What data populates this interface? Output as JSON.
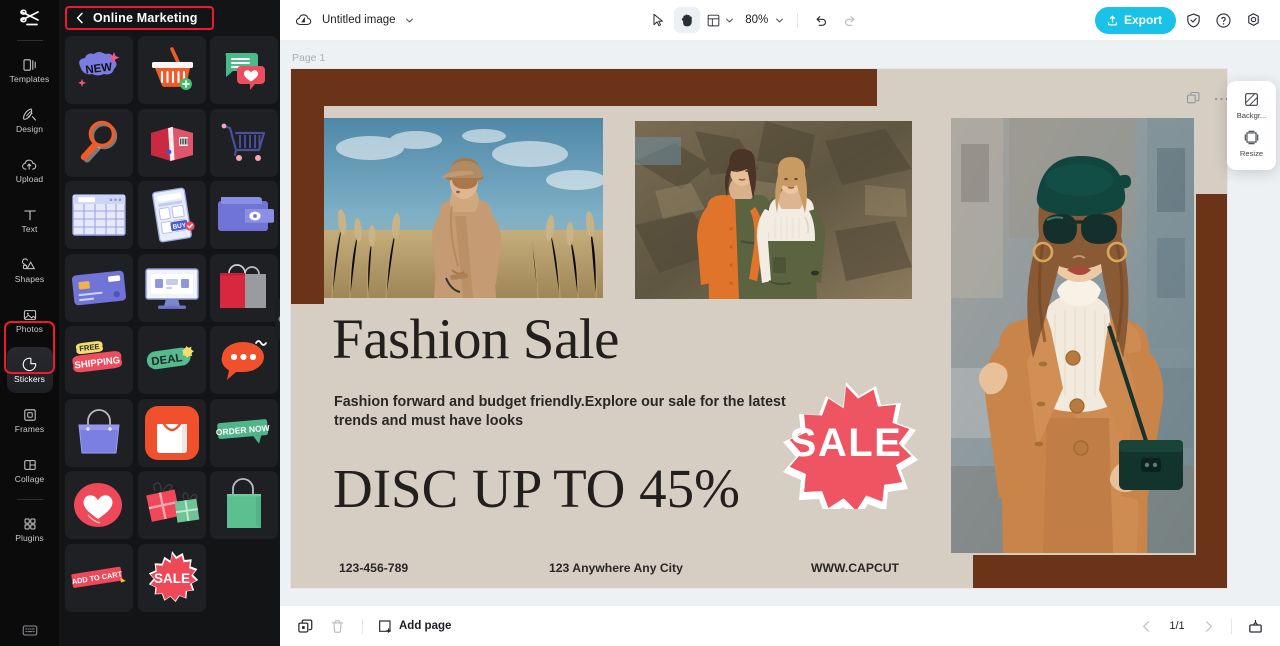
{
  "app": {
    "logo_icon": "capcut-logo-icon",
    "accent": "#19c2e6",
    "selection_outline": "#ee1b2e",
    "panel_bg": "#131416",
    "rail_bg": "#0b0b0c"
  },
  "rail": {
    "items": [
      {
        "label": "Templates",
        "icon": "templates-icon",
        "active": false
      },
      {
        "label": "Design",
        "icon": "design-icon",
        "active": false
      },
      {
        "label": "Upload",
        "icon": "upload-cloud-icon",
        "active": false
      },
      {
        "label": "Text",
        "icon": "text-icon",
        "active": false
      },
      {
        "label": "Shapes",
        "icon": "shapes-icon",
        "active": false
      },
      {
        "label": "Photos",
        "icon": "photos-icon",
        "active": false
      },
      {
        "label": "Stickers",
        "icon": "stickers-icon",
        "active": true
      },
      {
        "label": "Frames",
        "icon": "frames-icon",
        "active": false
      },
      {
        "label": "Collage",
        "icon": "collage-icon",
        "active": false
      },
      {
        "label": "Plugins",
        "icon": "plugins-icon",
        "active": false
      }
    ],
    "bottom_icon": "keyboard-shortcuts-icon"
  },
  "panel": {
    "back_icon": "chevron-left-icon",
    "title": "Online Marketing",
    "stickers": [
      {
        "name": "new-badge-sticker",
        "label": "NEW"
      },
      {
        "name": "shopping-basket-sticker",
        "label": ""
      },
      {
        "name": "chat-bubbles-heart-sticker",
        "label": ""
      },
      {
        "name": "magnifier-sticker",
        "label": ""
      },
      {
        "name": "parcel-box-sticker",
        "label": ""
      },
      {
        "name": "shopping-cart-outline-sticker",
        "label": ""
      },
      {
        "name": "calendar-sticker",
        "label": ""
      },
      {
        "name": "mobile-buy-sticker",
        "label": "BUY"
      },
      {
        "name": "wallet-sticker",
        "label": ""
      },
      {
        "name": "credit-card-sticker",
        "label": ""
      },
      {
        "name": "desktop-monitor-sticker",
        "label": ""
      },
      {
        "name": "paper-bags-sticker",
        "label": ""
      },
      {
        "name": "free-shipping-sticker",
        "label": "FREE SHIPPING"
      },
      {
        "name": "deal-sticker",
        "label": "DEAL"
      },
      {
        "name": "chat-dots-sticker",
        "label": ""
      },
      {
        "name": "handbag-outline-sticker",
        "label": ""
      },
      {
        "name": "shopping-bag-app-sticker",
        "label": ""
      },
      {
        "name": "order-now-sticker",
        "label": "ORDER NOW"
      },
      {
        "name": "heart-circle-sticker",
        "label": ""
      },
      {
        "name": "gift-boxes-sticker",
        "label": ""
      },
      {
        "name": "green-bag-sticker",
        "label": ""
      },
      {
        "name": "add-to-cart-sticker",
        "label": "ADD TO CART"
      },
      {
        "name": "sale-starburst-sticker",
        "label": "SALE"
      }
    ],
    "collapse_handle_icon": "panel-collapse-handle"
  },
  "topbar": {
    "project_icon": "cloud-saved-icon",
    "doc_title": "Untitled image",
    "title_caret_icon": "chevron-down-icon",
    "tools": [
      {
        "name": "select-tool",
        "icon": "cursor-arrow-icon",
        "selected": false
      },
      {
        "name": "hand-tool",
        "icon": "hand-icon",
        "selected": true
      },
      {
        "name": "layout-tool",
        "icon": "layout-panel-icon",
        "selected": false
      }
    ],
    "zoom_value": "80%",
    "zoom_caret_icon": "chevron-down-icon",
    "undo_icon": "undo-arrow-icon",
    "redo_icon": "redo-arrow-icon",
    "redo_disabled": true,
    "export_label": "Export",
    "export_icon": "upload-arrow-icon",
    "right_icons": [
      {
        "name": "shield-check-icon"
      },
      {
        "name": "help-question-icon"
      },
      {
        "name": "settings-gear-icon"
      }
    ]
  },
  "canvas": {
    "page_label": "Page 1",
    "page_tools": [
      {
        "name": "duplicate-page-icon"
      },
      {
        "name": "more-options-icon"
      }
    ],
    "context_menu": [
      {
        "label": "Backgr...",
        "icon": "background-icon"
      },
      {
        "label": "Resize",
        "icon": "resize-icon"
      }
    ]
  },
  "design": {
    "colors": {
      "paper": "#d6cec3",
      "brown": "#6b3318",
      "badge": "#ef5463",
      "ink": "#231f1c"
    },
    "headline": "Fashion Sale",
    "subhead": "Fashion forward and budget friendly.Explore our sale for the latest trends and must have looks",
    "discount": "DISC UP TO 45%",
    "badge_text": "SALE",
    "footer": [
      "123-456-789",
      "123 Anywhere Any City",
      "WWW.CAPCUT"
    ],
    "photos": [
      {
        "name": "photo-model-field",
        "alt": "woman in beige trench coat in dry grass field"
      },
      {
        "name": "photo-two-models",
        "alt": "two women in orange and olive outfits by rocks"
      },
      {
        "name": "photo-model-street",
        "alt": "woman with green beret sunglasses camel coat"
      }
    ]
  },
  "bottombar": {
    "duplicate_icon": "duplicate-icon",
    "delete_icon": "trash-icon",
    "delete_disabled": true,
    "add_page_icon": "add-page-icon",
    "add_page_label": "Add page",
    "prev_icon": "chevron-left-icon",
    "next_icon": "chevron-right-icon",
    "page_indicator": "1/1",
    "grid_view_icon": "page-preview-icon"
  }
}
